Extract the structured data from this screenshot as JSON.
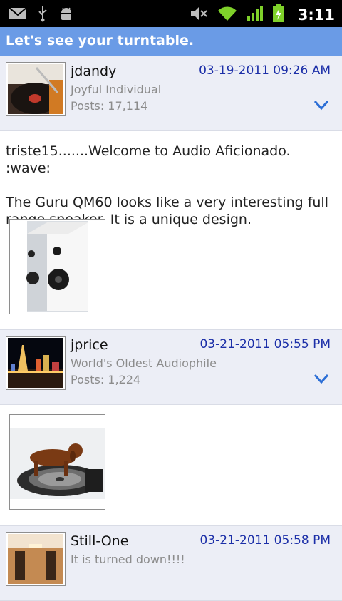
{
  "status_bar": {
    "time": "3:11",
    "icons": [
      "gmail-icon",
      "usb-icon",
      "android-debug-icon",
      "mute-icon",
      "wifi-icon",
      "signal-icon",
      "battery-charging-icon"
    ]
  },
  "thread": {
    "title": "Let's see your turntable."
  },
  "posts": [
    {
      "username": "jdandy",
      "user_title": "Joyful Individual",
      "posts": "Posts: 17,114",
      "date": "03-19-2011 09:26 AM",
      "body": [
        "triste15.......Welcome to Audio Aficionado. :wave:",
        "",
        "The Guru QM60 looks like a very interesting full range speaker. It is a unique design."
      ]
    },
    {
      "username": "jprice",
      "user_title": "World's Oldest Audiophile",
      "posts": "Posts: 1,224",
      "date": "03-21-2011 05:55 PM"
    },
    {
      "username": "Still-One",
      "user_title": "It is turned down!!!!",
      "date": "03-21-2011 05:58 PM"
    }
  ],
  "colors": {
    "title_bar": "#6a9be6",
    "header_bg": "#eceef6",
    "date_text": "#1c2fa8",
    "chevron": "#2d6fd6"
  }
}
